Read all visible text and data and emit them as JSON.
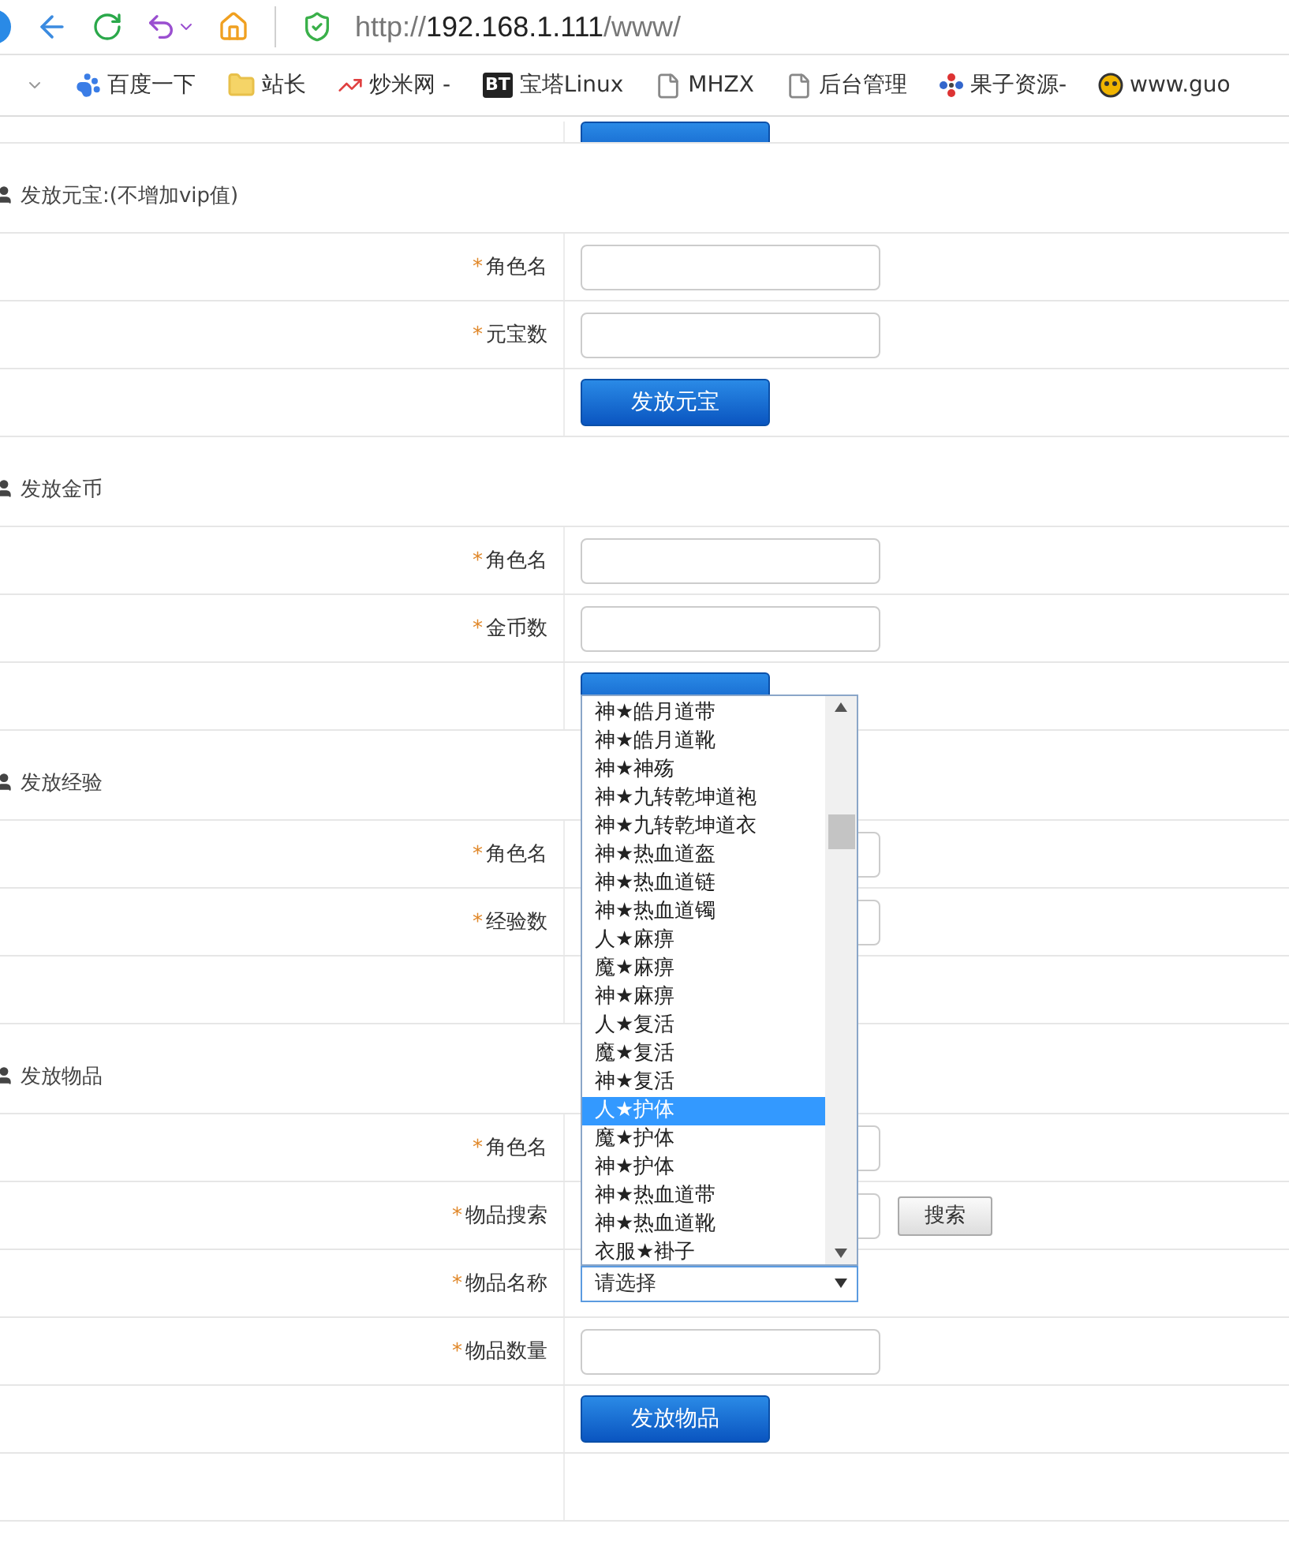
{
  "browser": {
    "url_scheme": "http://",
    "url_host": "192.168.1.111",
    "url_path": "/www/"
  },
  "bookmarks": [
    {
      "kind": "menu"
    },
    {
      "label": "百度一下",
      "kind": "paw"
    },
    {
      "label": "站长",
      "kind": "folder"
    },
    {
      "label": "炒米网 -",
      "kind": "chart"
    },
    {
      "label": "宝塔Linux",
      "kind": "badge",
      "icon_text": "BT"
    },
    {
      "label": "MHZX",
      "kind": "page"
    },
    {
      "label": "后台管理",
      "kind": "page"
    },
    {
      "label": "果子资源-",
      "kind": "dots"
    },
    {
      "label": "www.guo",
      "kind": "face"
    }
  ],
  "sections": [
    {
      "rows": [
        {
          "kind": "submit"
        }
      ]
    },
    {
      "title": "发放元宝:(不增加vip值)",
      "rows": [
        {
          "kind": "field",
          "label": "角色名",
          "mark": "*"
        },
        {
          "kind": "field",
          "label": "元宝数",
          "mark": "*"
        },
        {
          "kind": "submit",
          "label": "发放元宝"
        }
      ]
    },
    {
      "title": "发放金币",
      "rows": [
        {
          "kind": "field",
          "label": "角色名",
          "mark": "*"
        },
        {
          "kind": "field",
          "label": "金币数",
          "mark": "*"
        },
        {
          "kind": "submit"
        }
      ]
    },
    {
      "title": "发放经验",
      "rows": [
        {
          "kind": "field",
          "label": "角色名",
          "mark": "*"
        },
        {
          "kind": "field",
          "label": "经验数",
          "mark": "*"
        },
        {
          "kind": "empty"
        }
      ]
    },
    {
      "title": "发放物品",
      "rows": [
        {
          "kind": "field",
          "label": "角色名",
          "mark": "*"
        },
        {
          "kind": "search",
          "label": "物品搜索",
          "mark": "*",
          "button": "搜索"
        },
        {
          "kind": "select",
          "label": "物品名称",
          "mark": "*",
          "value": "请选择"
        },
        {
          "kind": "field",
          "label": "物品数量",
          "mark": "*"
        },
        {
          "kind": "submit",
          "label": "发放物品"
        },
        {
          "kind": "empty"
        }
      ]
    }
  ],
  "dropdown": {
    "options": [
      {
        "label": "神★皓月道带",
        "selected": false
      },
      {
        "label": "神★皓月道靴",
        "selected": false
      },
      {
        "label": "神★神殇",
        "selected": false
      },
      {
        "label": "神★九转乾坤道袍",
        "selected": false
      },
      {
        "label": "神★九转乾坤道衣",
        "selected": false
      },
      {
        "label": "神★热血道盔",
        "selected": false
      },
      {
        "label": "神★热血道链",
        "selected": false
      },
      {
        "label": "神★热血道镯",
        "selected": false
      },
      {
        "label": "人★麻痹",
        "selected": false
      },
      {
        "label": "魔★麻痹",
        "selected": false
      },
      {
        "label": "神★麻痹",
        "selected": false
      },
      {
        "label": "人★复活",
        "selected": false
      },
      {
        "label": "魔★复活",
        "selected": false
      },
      {
        "label": "神★复活",
        "selected": false
      },
      {
        "label": "人★护体",
        "selected": true
      },
      {
        "label": "魔★护体",
        "selected": false
      },
      {
        "label": "神★护体",
        "selected": false
      },
      {
        "label": "神★热血道带",
        "selected": false
      },
      {
        "label": "神★热血道靴",
        "selected": false
      },
      {
        "label": "衣服★褂子",
        "selected": false
      }
    ]
  }
}
